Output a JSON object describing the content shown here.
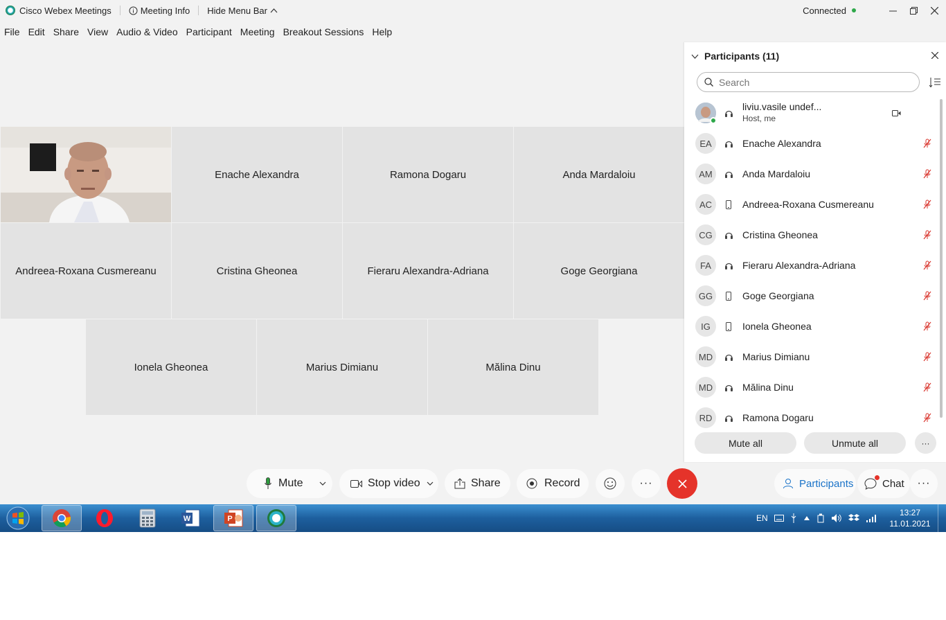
{
  "titlebar": {
    "app_name": "Cisco Webex Meetings",
    "meeting_info": "Meeting Info",
    "hide_menu": "Hide Menu Bar",
    "status": "Connected"
  },
  "menu": [
    "File",
    "Edit",
    "Share",
    "View",
    "Audio & Video",
    "Participant",
    "Meeting",
    "Breakout Sessions",
    "Help"
  ],
  "grid": {
    "tiles": [
      "Enache Alexandra",
      "Ramona Dogaru",
      "Anda Mardaloiu",
      "Andreea-Roxana Cusmereanu",
      "Cristina Gheonea",
      "Fieraru Alexandra-Adriana",
      "Goge Georgiana",
      "Ionela Gheonea",
      "Marius Dimianu",
      "Mălina Dinu"
    ]
  },
  "controls": {
    "mute": "Mute",
    "stop_video": "Stop video",
    "share": "Share",
    "record": "Record",
    "more": "···",
    "participants": "Participants",
    "chat": "Chat"
  },
  "panel": {
    "title": "Participants (11)",
    "search_placeholder": "Search",
    "host": {
      "name": "liviu.vasile undef...",
      "role": "Host, me"
    },
    "participants": [
      {
        "initials": "EA",
        "name": "Enache Alexandra",
        "device": "headset"
      },
      {
        "initials": "AM",
        "name": "Anda Mardaloiu",
        "device": "headset"
      },
      {
        "initials": "AC",
        "name": "Andreea-Roxana Cusmereanu",
        "device": "phone"
      },
      {
        "initials": "CG",
        "name": "Cristina Gheonea",
        "device": "headset"
      },
      {
        "initials": "FA",
        "name": "Fieraru Alexandra-Adriana",
        "device": "headset"
      },
      {
        "initials": "GG",
        "name": "Goge Georgiana",
        "device": "phone"
      },
      {
        "initials": "IG",
        "name": "Ionela Gheonea",
        "device": "phone"
      },
      {
        "initials": "MD",
        "name": "Marius Dimianu",
        "device": "headset"
      },
      {
        "initials": "MD",
        "name": "Mălina Dinu",
        "device": "headset"
      },
      {
        "initials": "RD",
        "name": "Ramona Dogaru",
        "device": "headset"
      }
    ],
    "mute_all": "Mute all",
    "unmute_all": "Unmute all"
  },
  "taskbar": {
    "language": "EN",
    "time": "13:27",
    "date": "11.01.2021"
  },
  "colors": {
    "accent": "#1a73c8",
    "end_call": "#e5332a",
    "muted": "#d9332b",
    "connected": "#2ea84a"
  }
}
